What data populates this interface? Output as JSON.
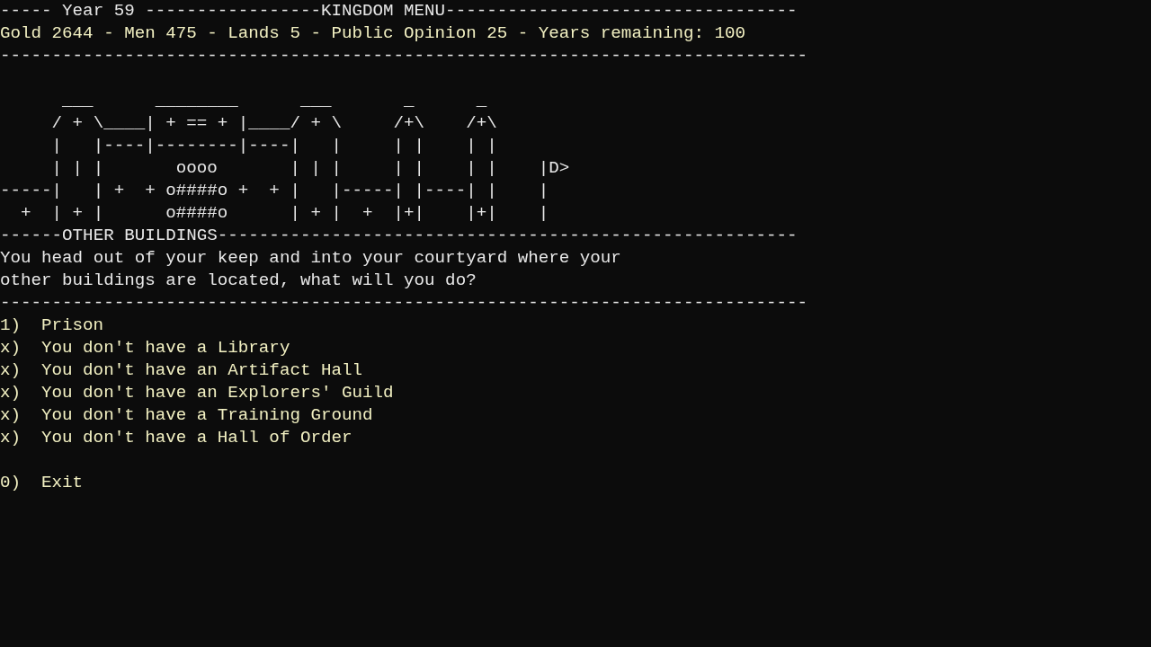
{
  "header": {
    "title_line": "----- Year 59 -----------------KINGDOM MENU----------------------------------",
    "status_line": "Gold 2644 - Men 475 - Lands 5 - Public Opinion 25 - Years remaining: 100",
    "rule": "------------------------------------------------------------------------------"
  },
  "art_lines": [
    "      ___      ________      ___       _      _",
    "     / + \\____| + == + |____/ + \\     /+\\    /+\\",
    "     |   |----|--------|----|   |     | |    | |",
    "     | | |       oooo       | | |     | |    | |    |D>",
    "-----|   | +  + o####o +  + |   |-----| |----| |    |",
    "  +  | + |      o####o      | + |  +  |+|    |+|    |"
  ],
  "section_title": "------OTHER BUILDINGS--------------------------------------------------------",
  "message_lines": [
    "You head out of your keep and into your courtyard where your",
    "other buildings are located, what will you do?"
  ],
  "rule": "------------------------------------------------------------------------------",
  "options": [
    {
      "key": "1)",
      "label": "Prison"
    },
    {
      "key": "x)",
      "label": "You don't have a Library"
    },
    {
      "key": "x)",
      "label": "You don't have an Artifact Hall"
    },
    {
      "key": "x)",
      "label": "You don't have an Explorers' Guild"
    },
    {
      "key": "x)",
      "label": "You don't have a Training Ground"
    },
    {
      "key": "x)",
      "label": "You don't have a Hall of Order"
    }
  ],
  "exit_option": {
    "key": "0)",
    "label": "Exit"
  }
}
